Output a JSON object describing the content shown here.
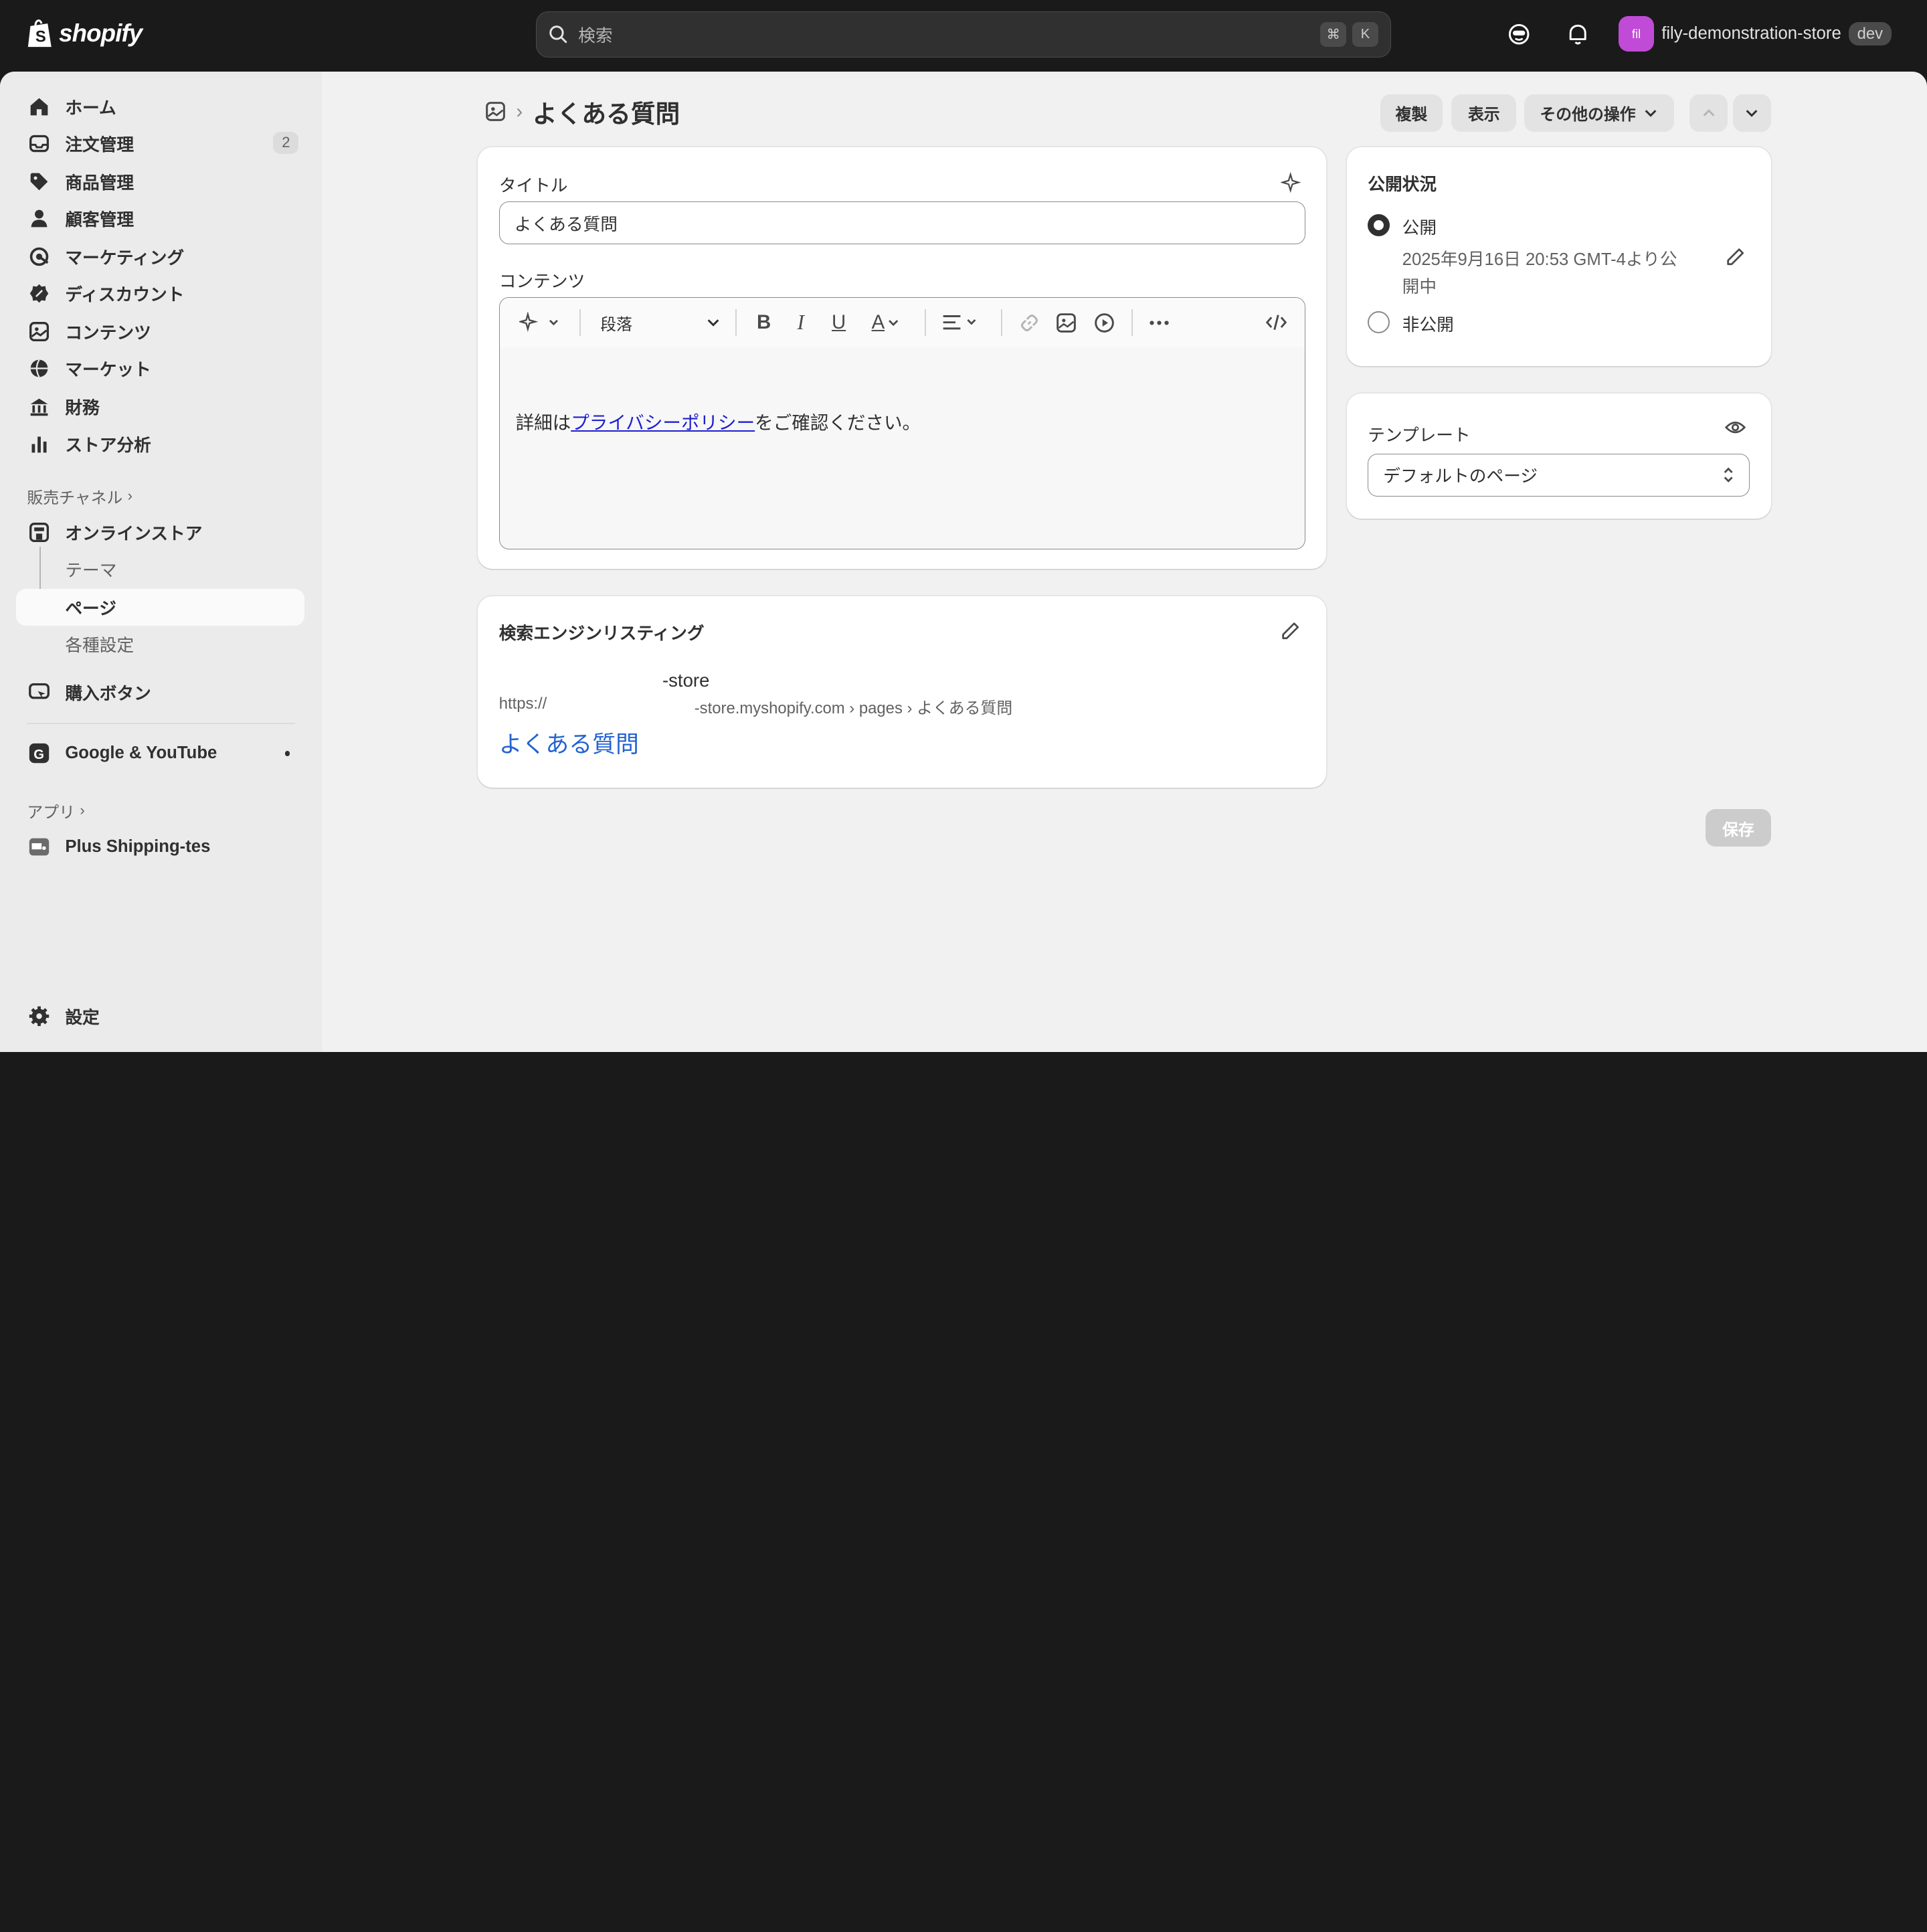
{
  "topbar": {
    "logo": "shopify",
    "search_placeholder": "検索",
    "shortcut_cmd": "⌘",
    "shortcut_key": "K",
    "store_initials": "fil",
    "store_name": "fily-demonstration-store",
    "store_badge": "dev"
  },
  "sidebar": {
    "items": [
      {
        "label": "ホーム",
        "icon": "home-icon"
      },
      {
        "label": "注文管理",
        "icon": "orders-icon",
        "badge": "2"
      },
      {
        "label": "商品管理",
        "icon": "tag-icon"
      },
      {
        "label": "顧客管理",
        "icon": "person-icon"
      },
      {
        "label": "マーケティング",
        "icon": "target-icon"
      },
      {
        "label": "ディスカウント",
        "icon": "discount-icon"
      },
      {
        "label": "コンテンツ",
        "icon": "content-icon"
      },
      {
        "label": "マーケット",
        "icon": "globe-icon"
      },
      {
        "label": "財務",
        "icon": "bank-icon"
      },
      {
        "label": "ストア分析",
        "icon": "bar-chart-icon"
      }
    ],
    "sales_channels_label": "販売チャネル",
    "online_store": "オンラインストア",
    "sub_items": [
      "テーマ",
      "ページ",
      "各種設定"
    ],
    "buy_button": "購入ボタン",
    "google": "Google & YouTube",
    "apps_label": "アプリ",
    "app_item": "Plus Shipping-tes",
    "settings": "設定"
  },
  "page": {
    "title": "よくある質問",
    "actions": {
      "duplicate": "複製",
      "view": "表示",
      "more": "その他の操作"
    }
  },
  "content_card": {
    "title_label": "タイトル",
    "title_value": "よくある質問",
    "content_label": "コンテンツ",
    "paragraph_select": "段落",
    "body_prefix": "詳細は",
    "body_link": "プライバシーポリシー",
    "body_suffix": "をご確認ください。"
  },
  "seo_card": {
    "heading": "検索エンジンリスティング",
    "site_name": "-store",
    "url_prefix": "https://",
    "url_path": "-store.myshopify.com › pages › よくある質問",
    "page_title": "よくある質問"
  },
  "visibility_card": {
    "heading": "公開状況",
    "public": "公開",
    "public_line1": "2025年9月16日 20:53 GMT-4より公",
    "public_line2": "開中",
    "hidden": "非公開",
    "selected": "公開"
  },
  "template_card": {
    "label": "テンプレート",
    "value": "デフォルトのページ"
  },
  "save_label": "保存",
  "colors": {
    "accent_link": "#2463d1",
    "store_avatar": "#c04bd6",
    "topbar": "#1a1a1a"
  }
}
